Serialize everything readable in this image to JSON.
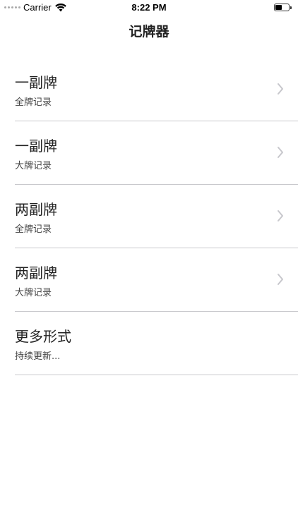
{
  "status": {
    "carrier": "Carrier",
    "time": "8:22 PM"
  },
  "nav": {
    "title": "记牌器"
  },
  "rows": [
    {
      "title": "一副牌",
      "subtitle": "全牌记录"
    },
    {
      "title": "一副牌",
      "subtitle": "大牌记录"
    },
    {
      "title": "两副牌",
      "subtitle": "全牌记录"
    },
    {
      "title": "两副牌",
      "subtitle": "大牌记录"
    },
    {
      "title": "更多形式",
      "subtitle": "持续更新..."
    }
  ],
  "icons": {
    "chevron": "chevron-right-icon",
    "wifi": "wifi-icon",
    "battery": "battery-icon"
  },
  "colors": {
    "separator": "#c8c8cc",
    "chevron": "#c7c7cc",
    "text": "#222222"
  }
}
